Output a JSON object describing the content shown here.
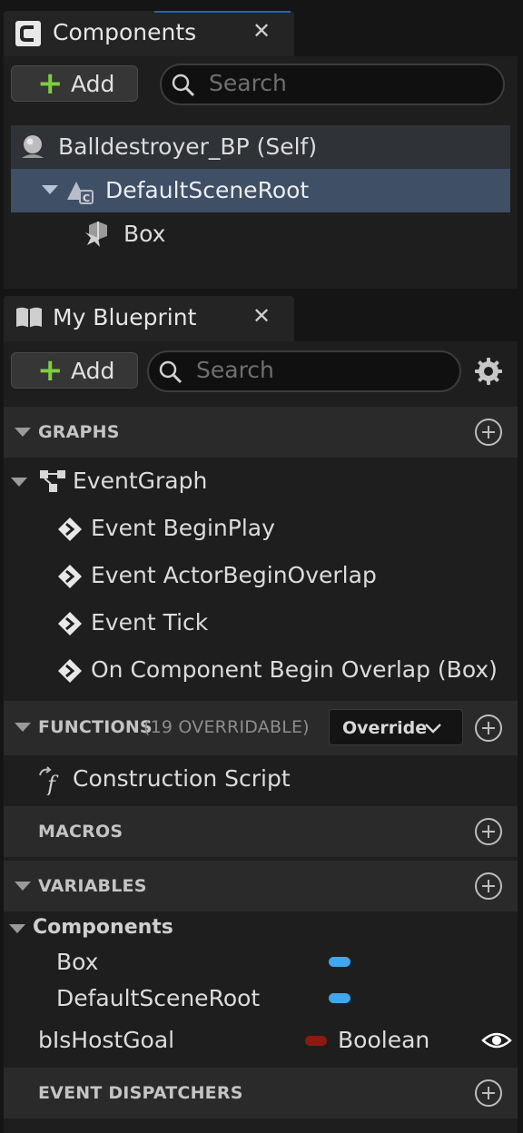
{
  "components_panel": {
    "tab_title": "Components",
    "add_label": "Add",
    "search_placeholder": "Search",
    "tree": {
      "self_label": "Balldestroyer_BP (Self)",
      "root_label": "DefaultSceneRoot",
      "child_label": "Box"
    }
  },
  "blueprint_panel": {
    "tab_title": "My Blueprint",
    "add_label": "Add",
    "search_placeholder": "Search",
    "graphs": {
      "header": "GRAPHS",
      "event_graph": "EventGraph",
      "events": [
        "Event BeginPlay",
        "Event ActorBeginOverlap",
        "Event Tick",
        "On Component Begin Overlap (Box)"
      ]
    },
    "functions": {
      "header": "FUNCTIONS",
      "overridable": "(19 OVERRIDABLE)",
      "override_label": "Override",
      "items": [
        "Construction Script"
      ]
    },
    "macros": {
      "header": "MACROS"
    },
    "variables": {
      "header": "VARIABLES",
      "category": "Components",
      "component_vars": [
        "Box",
        "DefaultSceneRoot"
      ],
      "var_name": "bIsHostGoal",
      "var_type": "Boolean"
    },
    "event_dispatchers": {
      "header": "EVENT DISPATCHERS"
    }
  },
  "colors": {
    "selected_row": "#3e4f66",
    "hover_row": "#2f3237",
    "object_pin": "#3ea7f0",
    "boolean_pin": "#8c1a10",
    "add_plus": "#7fcf3e"
  }
}
